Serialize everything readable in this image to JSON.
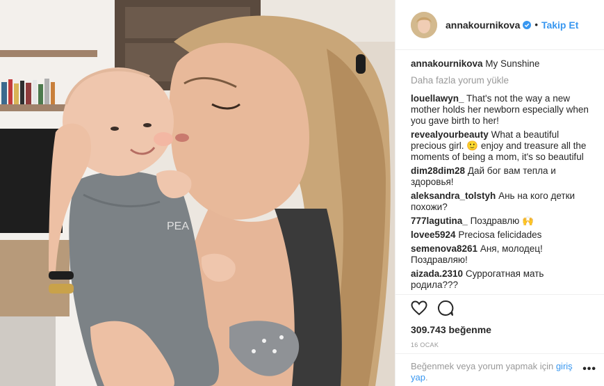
{
  "post": {
    "username": "annakournikova",
    "follow_label": "Takip Et",
    "dot": "•",
    "caption": "My Sunshine",
    "load_more": "Daha fazla yorum yükle",
    "photo_shirt_text": "PEA"
  },
  "comments": [
    {
      "user": "louellawyn_",
      "text": "That's not the way a new mother holds her newborn especially when you gave birth to her!"
    },
    {
      "user": "revealyourbeauty",
      "text": "What a beautiful precious girl. 🙂 enjoy and treasure all the moments of being a mom, it's so beautiful"
    },
    {
      "user": "dim28dim28",
      "text": "Дай бог вам тепла и здоровья!"
    },
    {
      "user": "aleksandra_tolstyh",
      "text": "Ань на кого детки похожи?"
    },
    {
      "user": "777lagutina_",
      "text": "Поздравлю 🙌"
    },
    {
      "user": "lovee5924",
      "text": "Preciosa felicidades"
    },
    {
      "user": "semenova8261",
      "text": "Аня, молодец! Поздравляю!"
    },
    {
      "user": "aizada.2310",
      "text": "Суррогатная мать родила???"
    }
  ],
  "footer": {
    "likes": "309.743 beğenme",
    "date": "16 OCAK",
    "login_text": "Beğenmek veya yorum yapmak için",
    "login_link": "giriş yap",
    "period": ".",
    "more_dots": "•••"
  },
  "icons": {
    "verified": "verified-badge-icon",
    "like": "heart-icon",
    "comment": "comment-bubble-icon",
    "options": "more-options-icon"
  },
  "colors": {
    "link_blue": "#3897f0",
    "text": "#262626",
    "muted": "#999999",
    "border": "#efefef"
  }
}
